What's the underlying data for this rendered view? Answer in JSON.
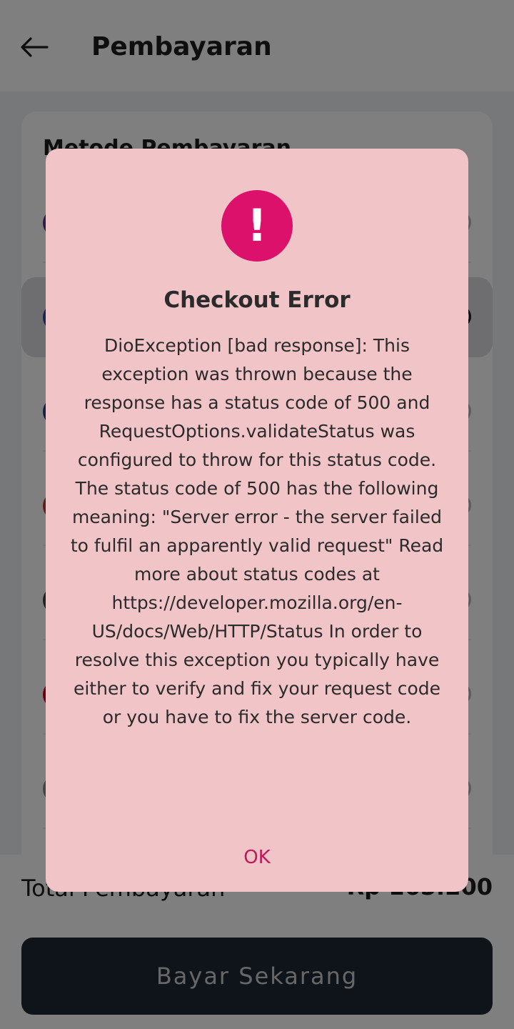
{
  "app_bar": {
    "title": "Pembayaran",
    "back_icon": "arrow-left-icon"
  },
  "payment": {
    "section_title": "Metode Pembayaran",
    "methods": [
      {
        "logo_color": "#5b3a8c",
        "selected": false
      },
      {
        "logo_color": "#2a4fa8",
        "selected": true
      },
      {
        "logo_color": "#2b3e8f",
        "selected": false
      },
      {
        "logo_color": "#c0392b",
        "selected": false
      },
      {
        "logo_color": "#444444",
        "selected": false
      },
      {
        "logo_color": "#d0021b",
        "selected": false
      },
      {
        "logo_color": "#888888",
        "selected": false
      }
    ]
  },
  "footer": {
    "total_label": "Total Pembayaran",
    "total_value": "Rp 165.200",
    "pay_button": "Bayar Sekarang"
  },
  "dialog": {
    "icon": "exclamation-icon",
    "icon_glyph": "!",
    "title": "Checkout Error",
    "message": "DioException [bad response]: This exception was thrown because the response has a status code of 500 and RequestOptions.validateStatus was configured to throw for this status code. The status code of 500 has the following meaning: \"Server error - the server failed to fulfil an apparently valid request\" Read more about status codes at https://developer.mozilla.org/en-US/docs/Web/HTTP/Status In order to resolve this exception you typically have either to verify and fix your request code or you have to fix the server code.",
    "ok_label": "OK"
  },
  "colors": {
    "dialog_bg": "#f1c5c8",
    "accent": "#dc116b",
    "ok_text": "#c2185b",
    "pay_button_bg": "#1f2937"
  }
}
